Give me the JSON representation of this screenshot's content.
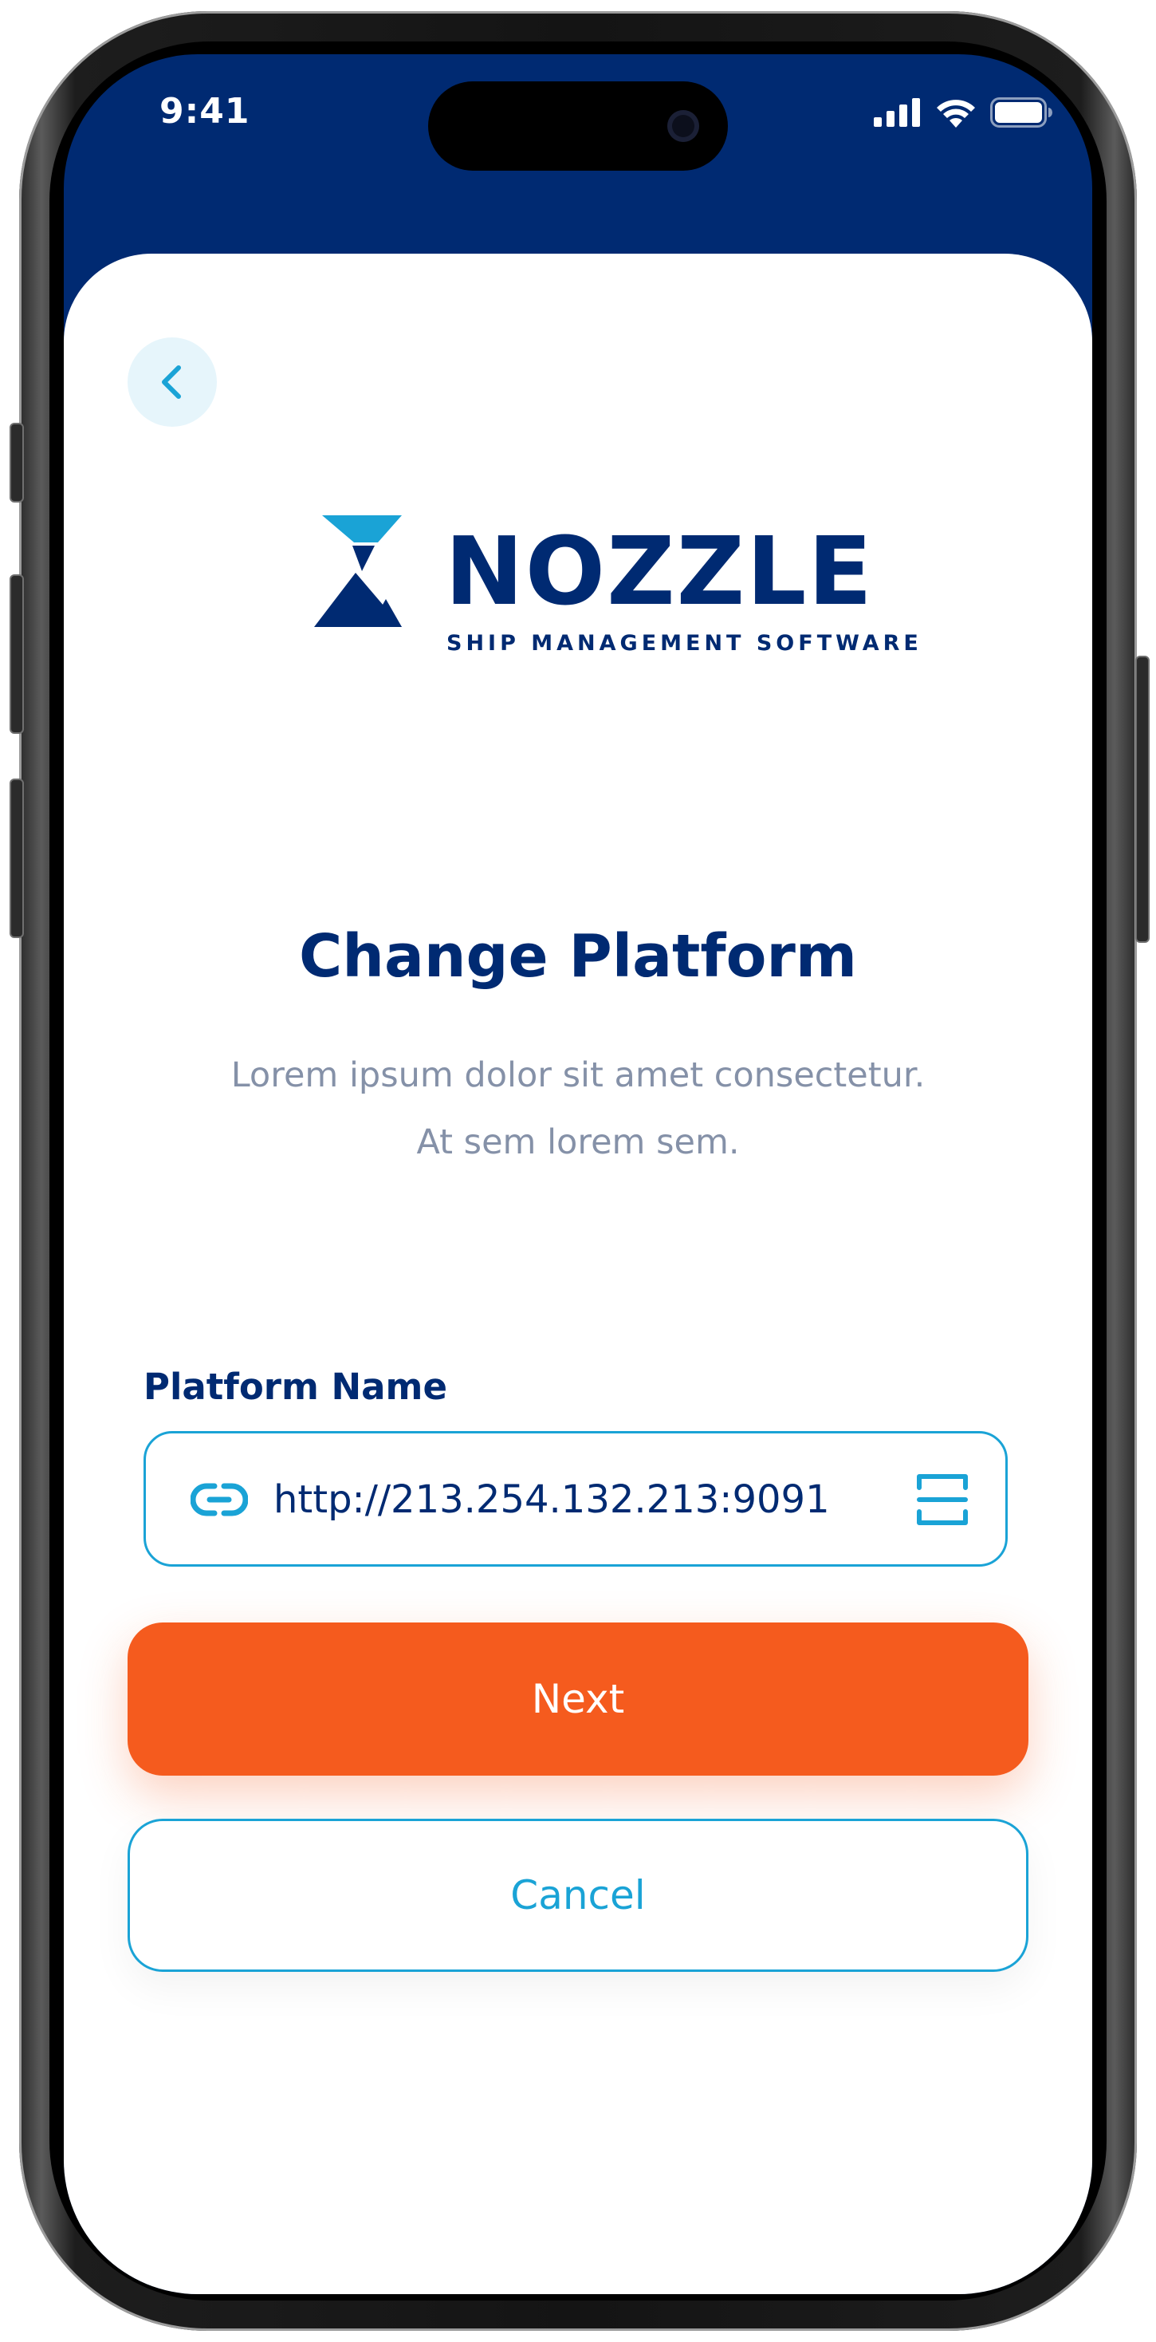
{
  "status_bar": {
    "time": "9:41"
  },
  "logo": {
    "wordmark": "NOZZLE",
    "tagline": "SHIP MANAGEMENT SOFTWARE"
  },
  "page": {
    "title": "Change Platform",
    "subtitle": "Lorem ipsum dolor sit amet consectetur. At sem lorem sem."
  },
  "form": {
    "platform_label": "Platform Name",
    "platform_value": "http://213.254.132.213:9091"
  },
  "buttons": {
    "next": "Next",
    "cancel": "Cancel"
  },
  "colors": {
    "brand_navy": "#002a72",
    "accent_blue": "#1aa3d6",
    "primary_orange": "#f55b1e",
    "muted_text": "#8591a8"
  },
  "icons": [
    "back-chevron-icon",
    "link-icon",
    "scan-icon",
    "signal-icon",
    "wifi-icon",
    "battery-icon"
  ]
}
